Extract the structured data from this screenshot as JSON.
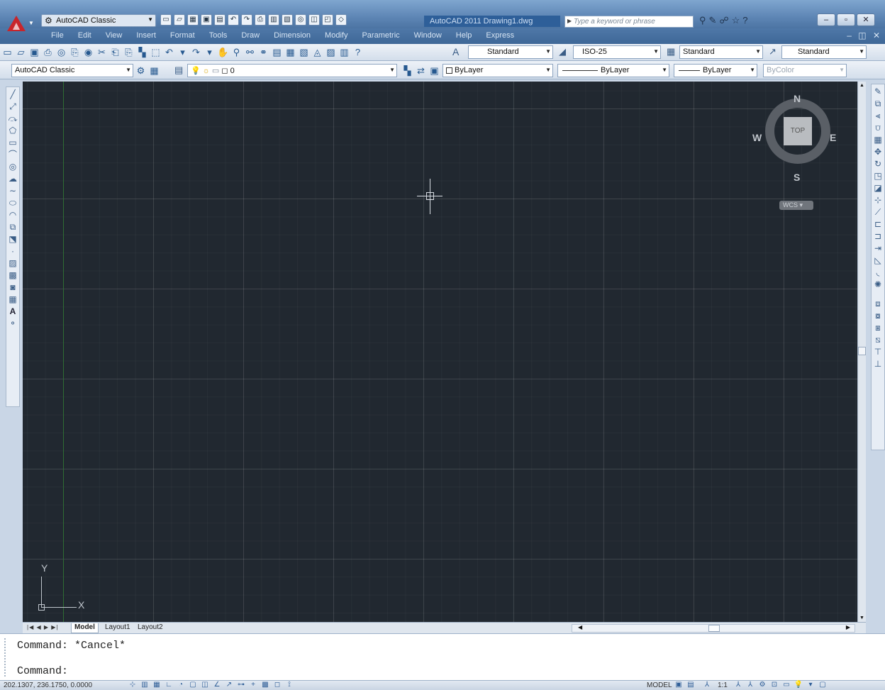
{
  "window": {
    "title": "AutoCAD 2011   Drawing1.dwg",
    "workspace": "AutoCAD Classic",
    "search_placeholder": "Type a keyword or phrase"
  },
  "menus": [
    "File",
    "Edit",
    "View",
    "Insert",
    "Format",
    "Tools",
    "Draw",
    "Dimension",
    "Modify",
    "Parametric",
    "Window",
    "Help",
    "Express"
  ],
  "styles_toolbar": {
    "text_style": "Standard",
    "dim_style": "ISO-25",
    "table_style": "Standard",
    "mleader_style": "Standard"
  },
  "layers_toolbar": {
    "workspace": "AutoCAD Classic",
    "layer": "0",
    "color": "ByLayer",
    "linetype": "ByLayer",
    "lineweight": "ByLayer",
    "plotstyle": "ByColor"
  },
  "viewcube": {
    "north": "N",
    "south": "S",
    "east": "E",
    "west": "W",
    "face": "TOP",
    "coord_system": "WCS"
  },
  "ucs_icon": {
    "x_label": "X",
    "y_label": "Y"
  },
  "tabs": [
    "Model",
    "Layout1",
    "Layout2"
  ],
  "command": {
    "history": "Command: *Cancel*",
    "prompt": "Command:"
  },
  "status": {
    "coordinates": "202.1307, 236.1750, 0.0000",
    "space": "MODEL",
    "annotation_scale": "1:1"
  },
  "colors": {
    "canvas": "#212830",
    "titlebar": "#5e86b5",
    "accent_red": "#c8252b"
  }
}
